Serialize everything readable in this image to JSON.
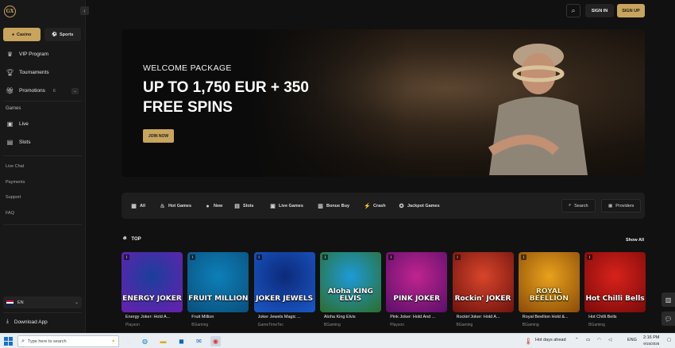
{
  "brand": {
    "logo_text": "GX"
  },
  "sidebar": {
    "tabs": {
      "casino": "Casino",
      "sports": "Sports"
    },
    "nav": {
      "vip": "VIP Program",
      "tournaments": "Tournaments",
      "promotions": "Promotions",
      "promotions_badge": "6"
    },
    "games_header": "Games",
    "games": {
      "live": "Live",
      "slots": "Slots"
    },
    "links": {
      "live_chat": "Live Chat",
      "payments": "Payments",
      "support": "Support",
      "faq": "FAQ"
    },
    "language": "EN",
    "download": "Download App"
  },
  "header": {
    "sign_in": "SIGN IN",
    "sign_up": "SIGN UP"
  },
  "hero": {
    "eyebrow": "WELCOME PACKAGE",
    "headline_1": "UP TO 1,750 EUR + 350",
    "headline_2": "FREE SPINS",
    "cta": "JOIN NOW"
  },
  "categories": {
    "all": "All",
    "hot": "Hot Games",
    "new": "New",
    "slots": "Slots",
    "live": "Live Games",
    "bonus": "Bonus Buy",
    "crash": "Crash",
    "jackpot": "Jackpot Games",
    "search": "Search",
    "providers": "Providers"
  },
  "top": {
    "label": "TOP",
    "show_all": "Show All"
  },
  "games": [
    {
      "name": "Energy Joker: Hold A...",
      "provider": "Playson",
      "art": "ENERGY JOKER",
      "colors": [
        "#1a3f9c",
        "#6a1fb0"
      ]
    },
    {
      "name": "Fruit Million",
      "provider": "BGaming",
      "art": "FRUIT MILLION",
      "colors": [
        "#0d7fb8",
        "#0a4f7c"
      ]
    },
    {
      "name": "Joker Jewels Magic ...",
      "provider": "GameTimeTec",
      "art": "JOKER JEWELS",
      "colors": [
        "#0c2a7a",
        "#1b58c8"
      ]
    },
    {
      "name": "Aloha King Elvis",
      "provider": "BGaming",
      "art": "Aloha KING ELVIS",
      "colors": [
        "#1d9ad8",
        "#2c6e2a"
      ]
    },
    {
      "name": "Pink Joker: Hold And ...",
      "provider": "Playson",
      "art": "PINK JOKER",
      "colors": [
        "#c0248f",
        "#5a0f6a"
      ]
    },
    {
      "name": "Rockin'Joker: Hold A...",
      "provider": "BGaming",
      "art": "Rockin' JOKER",
      "colors": [
        "#d8452b",
        "#6e120e"
      ]
    },
    {
      "name": "Royal Beellion Hold &...",
      "provider": "BGaming",
      "art": "ROYAL BEELLION",
      "colors": [
        "#e8a21c",
        "#8a4a08"
      ]
    },
    {
      "name": "Hot Chilli Bells",
      "provider": "BGaming",
      "art": "Hot Chilli Bells",
      "colors": [
        "#d8221b",
        "#7a0a0a"
      ]
    }
  ],
  "taskbar": {
    "search_placeholder": "Type here to search",
    "weather": "Hot days ahead",
    "lang": "ENG",
    "time": "2:16 PM",
    "date": "9/15/2026"
  },
  "colors": {
    "accent": "#c9a45c",
    "background": "#111111",
    "panel": "#1e1e1e"
  }
}
